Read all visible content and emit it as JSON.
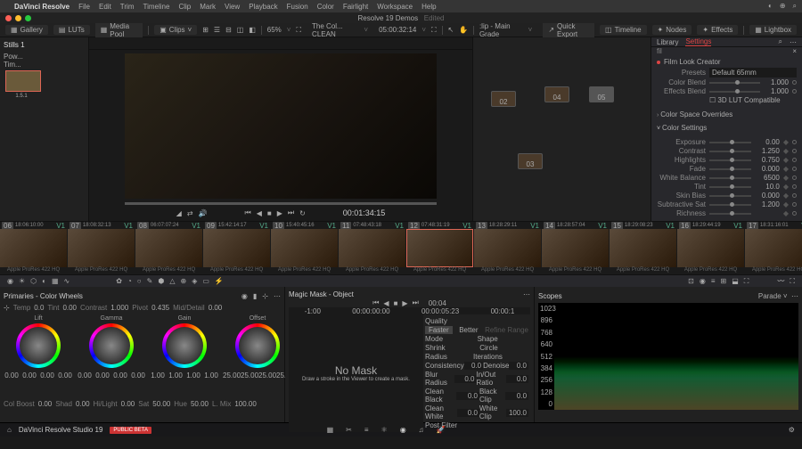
{
  "menubar": {
    "items": [
      "DaVinci Resolve",
      "File",
      "Edit",
      "Trim",
      "Timeline",
      "Clip",
      "Mark",
      "View",
      "Playback",
      "Fusion",
      "Color",
      "Fairlight",
      "Workspace",
      "Help"
    ]
  },
  "title": {
    "app": "Resolve 19 Demos",
    "status": "Edited"
  },
  "toolbar": {
    "gallery": "Gallery",
    "luts": "LUTs",
    "mediapool": "Media Pool",
    "clips": "Clips",
    "zoom": "65%",
    "clipname": "The Col... CLEAN",
    "record_tc": "05:00:32:14",
    "clip_label": ":lip - Main Grade",
    "quickexport": "Quick Export",
    "timeline": "Timeline",
    "nodes": "Nodes",
    "effects": "Effects",
    "lightbox": "Lightbox"
  },
  "stills": {
    "tabs": [
      "Stills 1",
      "Pow...",
      "Tim..."
    ],
    "thumb_label": "1.5.1"
  },
  "viewer": {
    "play_tc": "00:01:34:15"
  },
  "nodes_panel": {
    "nodes": [
      {
        "id": "02",
        "label": "02"
      },
      {
        "id": "04",
        "label": "04"
      },
      {
        "id": "05",
        "label": "05"
      },
      {
        "id": "03",
        "label": "03"
      }
    ]
  },
  "inspector": {
    "tabs": [
      "Library",
      "Settings"
    ],
    "search": "fil",
    "title": "Film Look Creator",
    "presets_label": "Presets",
    "presets_value": "Default 65mm",
    "color_blend_label": "Color Blend",
    "color_blend_value": "1.000",
    "effects_blend_label": "Effects Blend",
    "effects_blend_value": "1.000",
    "lut_compat": "3D LUT Compatible",
    "sect_overrides": "Color Space Overrides",
    "sect_color": "Color Settings",
    "params": [
      {
        "label": "Exposure",
        "value": "0.00"
      },
      {
        "label": "Contrast",
        "value": "1.250"
      },
      {
        "label": "Highlights",
        "value": "0.750"
      },
      {
        "label": "Fade",
        "value": "0.000"
      },
      {
        "label": "White Balance",
        "value": "6500"
      },
      {
        "label": "Tint",
        "value": "10.0"
      },
      {
        "label": "Skin Bias",
        "value": "0.000"
      },
      {
        "label": "Subtractive Sat",
        "value": "1.200"
      },
      {
        "label": "Richness",
        "value": ""
      }
    ]
  },
  "filmstrip": {
    "codec": "Apple ProRes 422 HQ",
    "clips": [
      {
        "n": "06",
        "tc": "18:06:10:00"
      },
      {
        "n": "07",
        "tc": "18:08:32:13"
      },
      {
        "n": "08",
        "tc": "06:07:07:24"
      },
      {
        "n": "09",
        "tc": "15:42:14:17"
      },
      {
        "n": "10",
        "tc": "15:40:45:16"
      },
      {
        "n": "11",
        "tc": "07:48:43:18"
      },
      {
        "n": "12",
        "tc": "07:48:31:19",
        "sel": true
      },
      {
        "n": "13",
        "tc": "18:28:29:11"
      },
      {
        "n": "14",
        "tc": "18:28:57:04"
      },
      {
        "n": "15",
        "tc": "18:29:08:23"
      },
      {
        "n": "16",
        "tc": "18:29:44:19"
      },
      {
        "n": "17",
        "tc": "18:31:16:01"
      }
    ]
  },
  "wheels": {
    "title": "Primaries - Color Wheels",
    "params": [
      {
        "l": "Temp",
        "v": "0.0"
      },
      {
        "l": "Tint",
        "v": "0.00"
      },
      {
        "l": "Contrast",
        "v": "1.000"
      },
      {
        "l": "Pivot",
        "v": "0.435"
      },
      {
        "l": "Mid/Detail",
        "v": "0.00"
      }
    ],
    "items": [
      {
        "name": "Lift",
        "vals": [
          "0.00",
          "0.00",
          "0.00",
          "0.00"
        ]
      },
      {
        "name": "Gamma",
        "vals": [
          "0.00",
          "0.00",
          "0.00",
          "0.00"
        ]
      },
      {
        "name": "Gain",
        "vals": [
          "1.00",
          "1.00",
          "1.00",
          "1.00"
        ]
      },
      {
        "name": "Offset",
        "vals": [
          "25.00",
          "25.00",
          "25.00",
          "25.00"
        ]
      }
    ],
    "footer": [
      {
        "l": "Col Boost",
        "v": "0.00"
      },
      {
        "l": "Shad",
        "v": "0.00"
      },
      {
        "l": "Hi/Light",
        "v": "0.00"
      },
      {
        "l": "Sat",
        "v": "50.00"
      },
      {
        "l": "Hue",
        "v": "50.00"
      },
      {
        "l": "L. Mix",
        "v": "100.00"
      }
    ]
  },
  "mask": {
    "title": "Magic Mask - Object",
    "ruler": [
      "-1:00",
      "00:00:00:00",
      "00:00:05:23",
      "00:00:1"
    ],
    "tc": "00:04",
    "empty_title": "No Mask",
    "empty_sub": "Draw a stroke in the Viewer to create a mask.",
    "props": [
      {
        "l": "Quality",
        "a": "Faster",
        "b": "Better"
      },
      {
        "l": "Mode",
        "v": "",
        "l2": "Shape"
      },
      {
        "l": "Shrink",
        "v": "",
        "l2": "Circle"
      },
      {
        "l": "Radius",
        "v": "",
        "l2": "Iterations"
      },
      {
        "l": "Consistency",
        "v": "0.0",
        "l2": "Denoise",
        "v2": "0.0"
      },
      {
        "l": "Blur Radius",
        "v": "0.0",
        "l2": "In/Out Ratio",
        "v2": "0.0"
      },
      {
        "l": "Clean Black",
        "v": "0.0",
        "l2": "Black Clip",
        "v2": "0.0"
      },
      {
        "l": "Clean White",
        "v": "0.0",
        "l2": "White Clip",
        "v2": "100.0"
      },
      {
        "l": "Post Filter"
      }
    ]
  },
  "scopes": {
    "title": "Scopes",
    "mode": "Parade",
    "yaxis": [
      "1023",
      "896",
      "768",
      "640",
      "512",
      "384",
      "256",
      "128",
      "0"
    ]
  },
  "pages": {
    "logo": "DaVinci Resolve Studio 19",
    "beta": "PUBLIC BETA"
  }
}
